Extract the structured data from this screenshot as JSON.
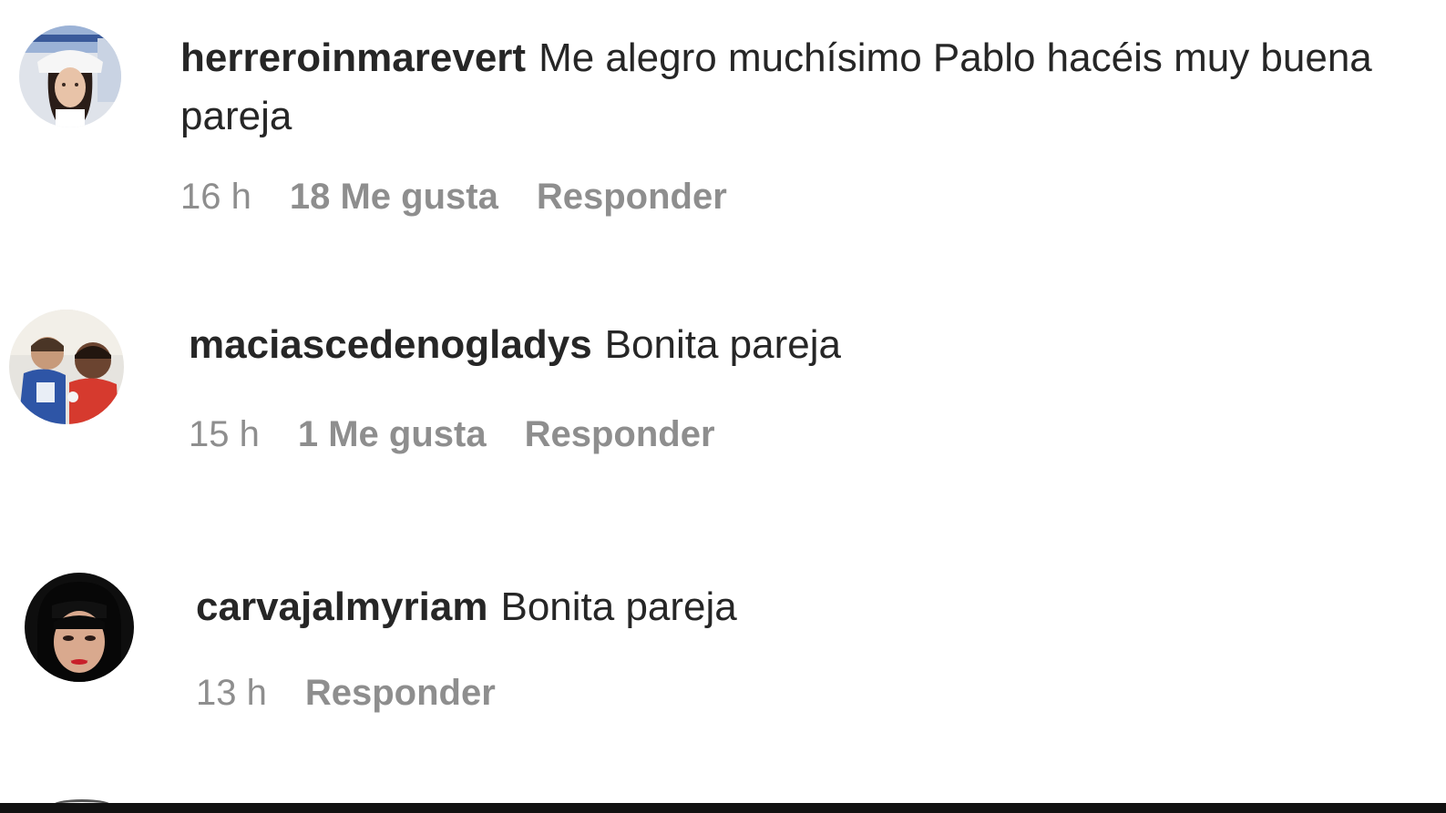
{
  "comments": [
    {
      "username": "herreroinmarevert",
      "text": "Me alegro muchísimo Pablo hacéis muy buena pareja",
      "time": "16 h",
      "likes": "18 Me gusta",
      "reply": "Responder",
      "avatar": "avatar-woman-white-hat"
    },
    {
      "username": "maciascedenogladys",
      "text": "Bonita pareja",
      "time": "15 h",
      "likes": "1 Me gusta",
      "reply": "Responder",
      "avatar": "avatar-two-children"
    },
    {
      "username": "carvajalmyriam",
      "text": "Bonita pareja",
      "time": "13 h",
      "likes": "",
      "reply": "Responder",
      "avatar": "avatar-woman-dark-hair"
    }
  ],
  "colors": {
    "text": "#262626",
    "secondary": "#8e8e8e",
    "background": "#ffffff"
  }
}
